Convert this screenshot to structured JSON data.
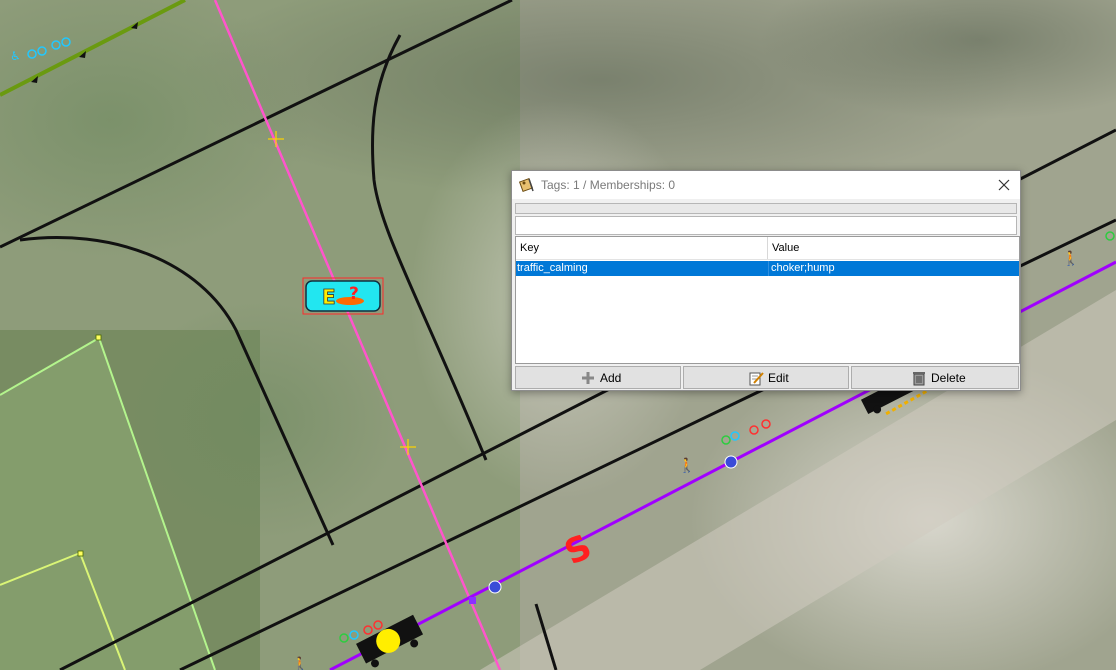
{
  "map": {
    "background": "aerial-imagery",
    "colors": {
      "building_outline": "#111111",
      "highway_pink": "#ff55cc",
      "cycleway_purple": "#a000ff",
      "path_green": "#6a9a10",
      "landuse_outline": "#b8ff90"
    },
    "icons": [
      "crosshair-icon",
      "poi-emergency-icon",
      "bicycle-icon",
      "pedestrian-icon",
      "traffic-calming-icon",
      "node-icon"
    ],
    "selected_object_label": "S"
  },
  "dialog": {
    "title_icon": "tag-icon",
    "title": "Tags: 1 / Memberships: 0",
    "close_icon": "close-icon",
    "search_placeholder": "",
    "table": {
      "headers": [
        "Key",
        "Value"
      ],
      "rows": [
        {
          "key": "traffic_calming",
          "value": "choker;hump",
          "selected": true
        }
      ]
    },
    "buttons": {
      "add": {
        "label": "Add",
        "icon": "plus-icon"
      },
      "edit": {
        "label": "Edit",
        "icon": "edit-icon"
      },
      "delete": {
        "label": "Delete",
        "icon": "trash-icon"
      }
    },
    "selection_color": "#0078d7"
  }
}
